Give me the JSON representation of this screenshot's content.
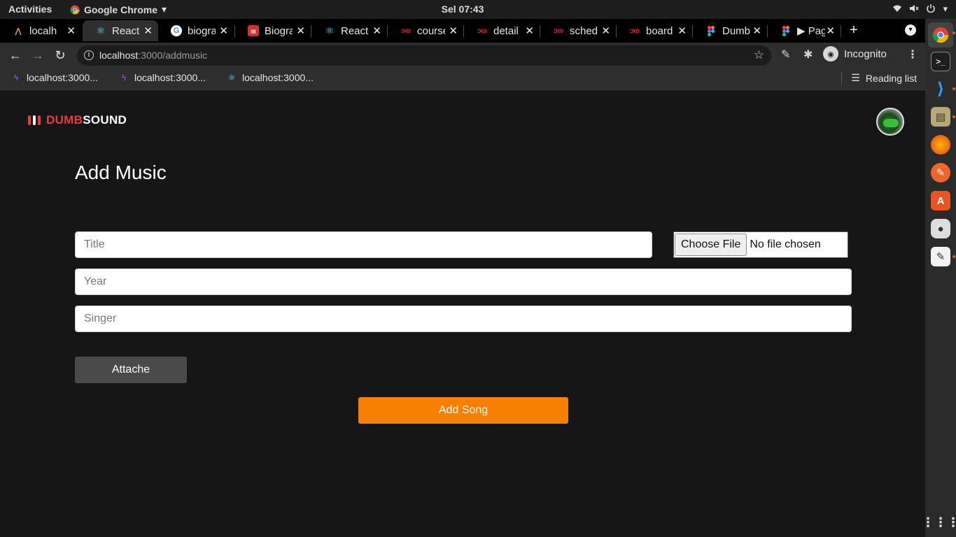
{
  "system_bar": {
    "activities": "Activities",
    "app_name": "Google Chrome",
    "clock": "Sel 07:43"
  },
  "tabs": [
    {
      "label": "localho",
      "icon": "arrow-logo-icon",
      "active": false
    },
    {
      "label": "React A",
      "icon": "react-icon",
      "active": true
    },
    {
      "label": "biogra",
      "icon": "google-icon",
      "active": false
    },
    {
      "label": "Biogra",
      "icon": "site-icon",
      "active": false
    },
    {
      "label": "React-",
      "icon": "react-icon",
      "active": false
    },
    {
      "label": "course",
      "icon": "dw-icon",
      "active": false
    },
    {
      "label": "detail",
      "icon": "dw-icon",
      "active": false
    },
    {
      "label": "schedu",
      "icon": "dw-icon",
      "active": false
    },
    {
      "label": "board",
      "icon": "dw-icon",
      "active": false
    },
    {
      "label": "Dumb",
      "icon": "figma-icon",
      "active": false
    },
    {
      "label": "▶ Pag",
      "icon": "figma-icon",
      "active": false
    }
  ],
  "address_bar": {
    "host": "localhost",
    "path": ":3000/addmusic"
  },
  "profile": {
    "label": "Incognito"
  },
  "bookmarks": [
    {
      "label": "localhost:3000...",
      "icon": "bolt-icon"
    },
    {
      "label": "localhost:3000...",
      "icon": "bolt-icon"
    },
    {
      "label": "localhost:3000...",
      "icon": "react-icon"
    }
  ],
  "reading_list": "Reading list",
  "app": {
    "logo_part1": "DUMB",
    "logo_part2": "SOUND",
    "page_title": "Add Music",
    "form": {
      "title_placeholder": "Title",
      "year_placeholder": "Year",
      "singer_placeholder": "Singer",
      "choose_file_label": "Choose File",
      "file_status": "No file chosen",
      "attache_label": "Attache",
      "add_song_label": "Add Song"
    }
  },
  "colors": {
    "accent_orange": "#f58003",
    "logo_red": "#e53d3d",
    "page_bg": "#161616"
  }
}
